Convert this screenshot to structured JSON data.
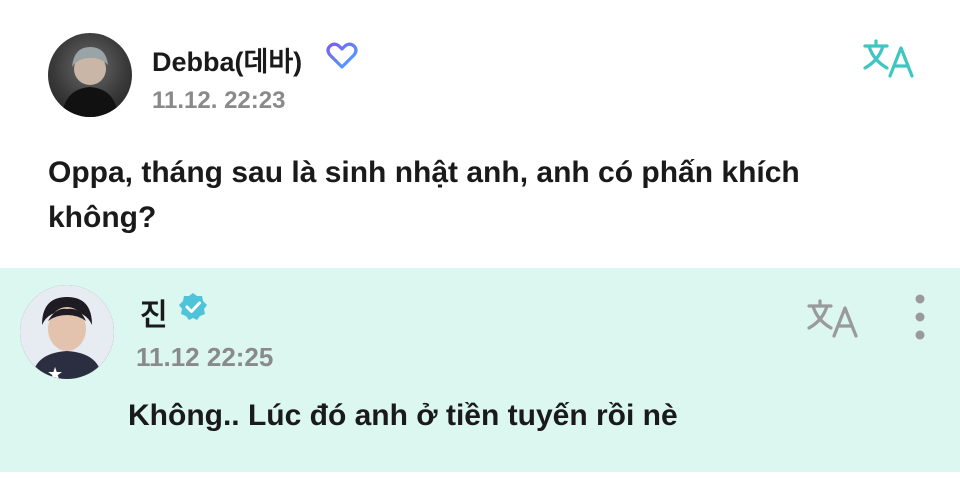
{
  "post": {
    "author": "Debba(데바)",
    "timestamp": "11.12. 22:23",
    "text": "Oppa, tháng sau là sinh nhật anh, anh có phấn khích không?",
    "badge_icon": "heart-badge-icon",
    "translate_icon": "translate-icon",
    "accent_color": "#3fc6c0",
    "badge_colors": [
      "#7b5cf0",
      "#4aa8ff"
    ]
  },
  "reply": {
    "author": "진",
    "timestamp": "11.12 22:25",
    "text": "Không.. Lúc đó anh ở tiền tuyến rồi nè",
    "badge_icon": "verified-badge-icon",
    "translate_icon": "translate-icon",
    "more_icon": "more-vertical-icon",
    "background_color": "#dcf6f0",
    "badge_color": "#4fc3d8"
  }
}
